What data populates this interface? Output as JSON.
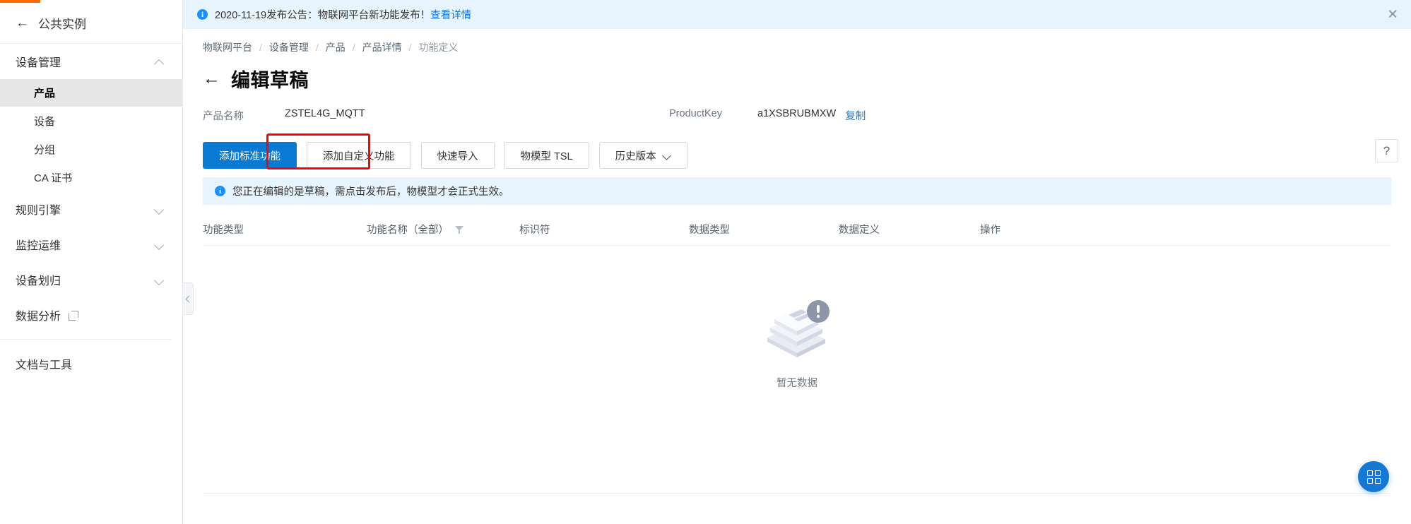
{
  "sidebar": {
    "back_label": "公共实例",
    "back_icon": "arrow-left-icon",
    "groups": [
      {
        "label": "设备管理",
        "expanded": true,
        "chevron": "chevron-up-icon",
        "items": [
          {
            "label": "产品",
            "active": true
          },
          {
            "label": "设备",
            "active": false
          },
          {
            "label": "分组",
            "active": false
          },
          {
            "label": "CA 证书",
            "active": false
          }
        ]
      },
      {
        "label": "规则引擎",
        "expanded": false,
        "chevron": "chevron-down-icon"
      },
      {
        "label": "监控运维",
        "expanded": false,
        "chevron": "chevron-down-icon"
      },
      {
        "label": "设备划归",
        "expanded": false,
        "chevron": "chevron-down-icon"
      }
    ],
    "data_analysis": "数据分析",
    "data_analysis_icon": "external-link-icon",
    "docs_tools": "文档与工具",
    "collapse_icon": "chevron-left-icon"
  },
  "notice": {
    "icon": "info-circle-icon",
    "text": "2020-11-19发布公告：物联网平台新功能发布！",
    "link": "查看详情",
    "close_icon": "close-icon"
  },
  "breadcrumb": {
    "items": [
      "物联网平台",
      "设备管理",
      "产品",
      "产品详情",
      "功能定义"
    ],
    "separator": "/"
  },
  "page": {
    "back_icon": "arrow-left-icon",
    "title": "编辑草稿"
  },
  "meta": {
    "product_name_label": "产品名称",
    "product_name_value": "ZSTEL4G_MQTT",
    "product_key_label": "ProductKey",
    "product_key_value": "a1XSBRUBMXW",
    "copy_label": "复制"
  },
  "toolbar": {
    "buttons": [
      {
        "label": "添加标准功能",
        "primary": true,
        "highlighted": false
      },
      {
        "label": "添加自定义功能",
        "primary": false,
        "highlighted": true
      },
      {
        "label": "快速导入",
        "primary": false,
        "highlighted": false
      },
      {
        "label": "物模型 TSL",
        "primary": false,
        "highlighted": false
      },
      {
        "label": "历史版本",
        "primary": false,
        "highlighted": false,
        "dropdown": true,
        "chevron": "chevron-down-icon"
      }
    ],
    "help_label": "?"
  },
  "alert": {
    "icon": "info-circle-icon",
    "text": "您正在编辑的是草稿，需点击发布后，物模型才会正式生效。"
  },
  "table": {
    "columns": [
      "功能类型",
      "功能名称（全部）",
      "标识符",
      "数据类型",
      "数据定义",
      "操作"
    ],
    "filter_icon": "filter-icon",
    "rows": [],
    "empty_text": "暂无数据",
    "empty_icon": "no-data-illustration"
  },
  "fab": {
    "icon": "grid-apps-icon"
  },
  "colors": {
    "accent_orange": "#ff6a00",
    "primary_blue": "#0a7ad4",
    "link_blue": "#1677d2",
    "notice_bg": "#e8f4fd",
    "highlight_red": "#ff0000",
    "active_item_bg": "#e6e6e6"
  }
}
